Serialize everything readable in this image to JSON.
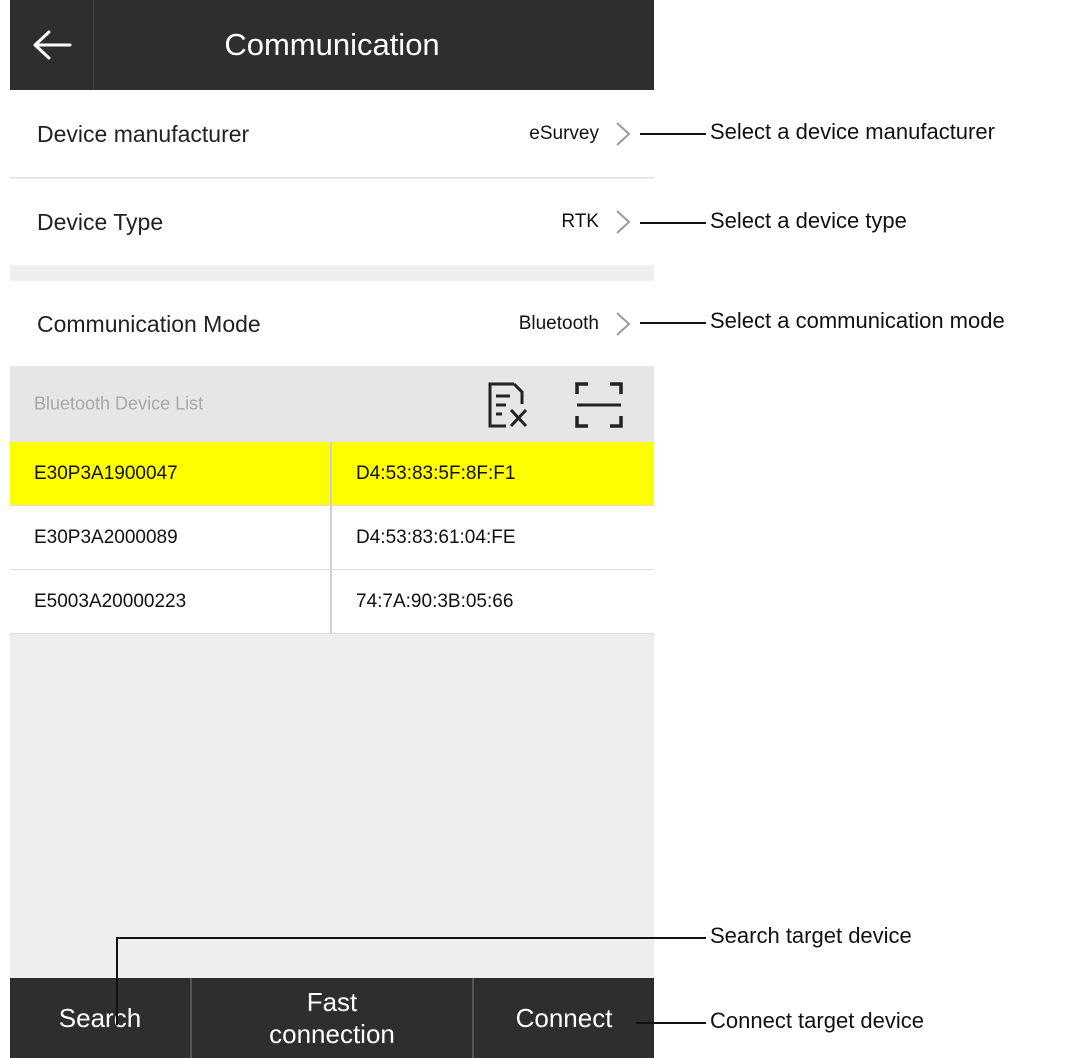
{
  "header": {
    "title": "Communication",
    "back_icon": "arrow-left-icon"
  },
  "settings": {
    "manufacturer": {
      "label": "Device manufacturer",
      "value": "eSurvey"
    },
    "device_type": {
      "label": "Device Type",
      "value": "RTK"
    },
    "comm_mode": {
      "label": "Communication Mode",
      "value": "Bluetooth"
    }
  },
  "list": {
    "title": "Bluetooth Device List",
    "icons": [
      "clear-list-icon",
      "scan-icon"
    ],
    "rows": [
      {
        "name": "E30P3A1900047",
        "mac": "D4:53:83:5F:8F:F1",
        "selected": true
      },
      {
        "name": "E30P3A2000089",
        "mac": "D4:53:83:61:04:FE",
        "selected": false
      },
      {
        "name": "E5003A20000223",
        "mac": "74:7A:90:3B:05:66",
        "selected": false
      }
    ]
  },
  "bottom": {
    "search": "Search",
    "fast": "Fast connection",
    "connect": "Connect"
  },
  "annotations": {
    "manufacturer": "Select a device manufacturer",
    "device_type": "Select a device type",
    "comm_mode": "Select a communication mode",
    "search": "Search target device",
    "connect": "Connect target device"
  },
  "colors": {
    "bar": "#2e2e2e",
    "selected_row": "#ffff00",
    "background": "#eeeeee"
  }
}
